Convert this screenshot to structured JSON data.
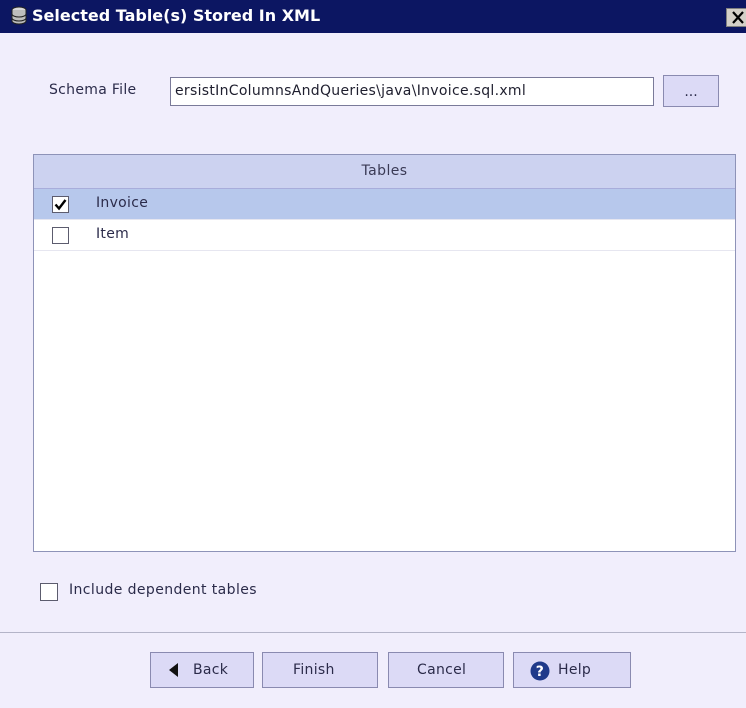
{
  "window": {
    "title": "Selected Table(s) Stored In XML",
    "icon": "database-icon",
    "close_icon": "close-icon"
  },
  "schema": {
    "label": "Schema File",
    "value": "ersistInColumnsAndQueries\\java\\Invoice.sql.xml",
    "browse_label": "..."
  },
  "tables": {
    "header": "Tables",
    "rows": [
      {
        "label": "Invoice",
        "checked": true,
        "selected": true
      },
      {
        "label": "Item",
        "checked": false,
        "selected": false
      }
    ]
  },
  "include_dependent": {
    "label": "Include dependent tables",
    "checked": false
  },
  "buttons": {
    "back": "Back",
    "finish": "Finish",
    "cancel": "Cancel",
    "help": "Help"
  },
  "colors": {
    "titlebar": "#0c1662",
    "background": "#f1eefc",
    "selected_row": "#b7c8ec",
    "table_header": "#ccd2f0",
    "button": "#dcdaf6"
  }
}
